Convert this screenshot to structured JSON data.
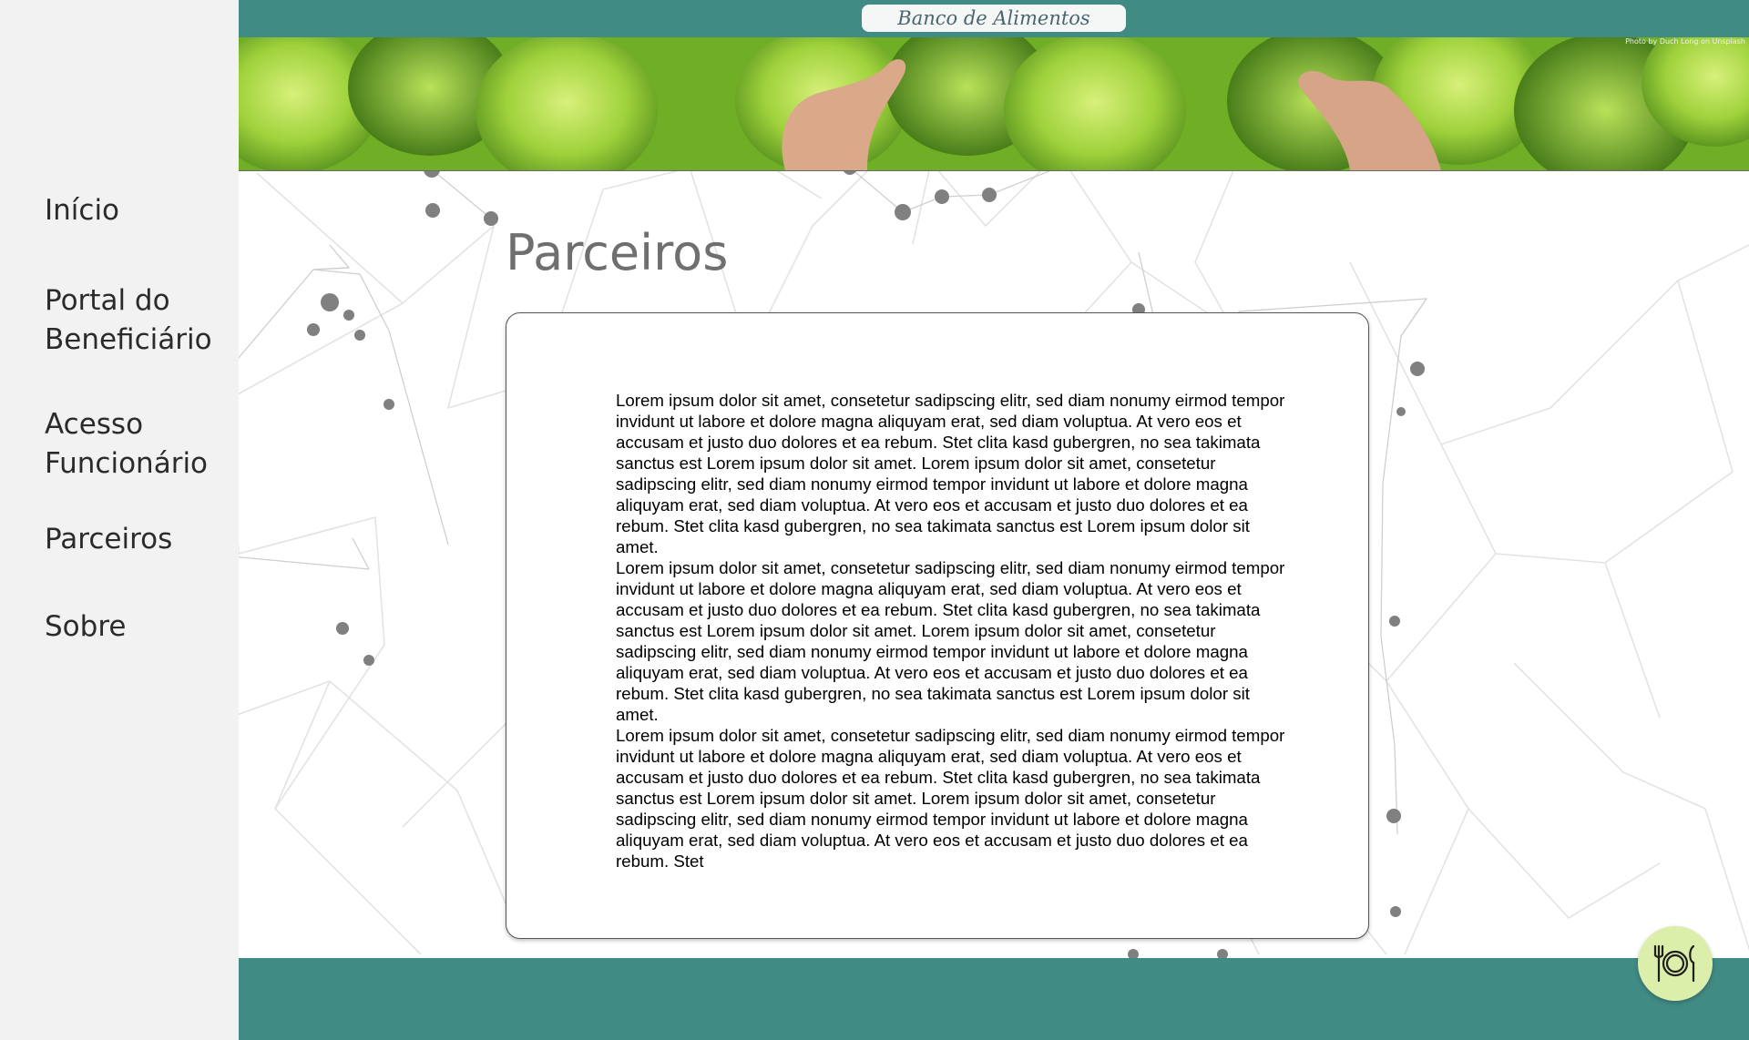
{
  "sidebar": {
    "items": [
      {
        "label": "Início"
      },
      {
        "label": "Portal do Beneficiário"
      },
      {
        "label": "Acesso Funcionário"
      },
      {
        "label": "Parceiros"
      },
      {
        "label": "Sobre"
      }
    ]
  },
  "header": {
    "brand": "Banco de Alimentos",
    "photo_credit": "Photo by Duch Long on Unsplash"
  },
  "main": {
    "title": "Parceiros",
    "paragraphs": [
      "Lorem ipsum dolor sit amet, consetetur sadipscing elitr, sed diam nonumy eirmod tempor invidunt ut labore et dolore magna aliquyam erat, sed diam voluptua. At vero eos et accusam et justo duo dolores et ea rebum. Stet clita kasd gubergren, no sea takimata sanctus est Lorem ipsum dolor sit amet. Lorem ipsum dolor sit amet, consetetur sadipscing elitr, sed diam nonumy eirmod tempor invidunt ut labore et dolore magna aliquyam erat, sed diam voluptua. At vero eos et accusam et justo duo dolores et ea rebum. Stet clita kasd gubergren, no sea takimata sanctus est Lorem ipsum dolor sit amet.",
      "Lorem ipsum dolor sit amet, consetetur sadipscing elitr, sed diam nonumy eirmod tempor invidunt ut labore et dolore magna aliquyam erat, sed diam voluptua. At vero eos et accusam et justo duo dolores et ea rebum. Stet clita kasd gubergren, no sea takimata sanctus est Lorem ipsum dolor sit amet. Lorem ipsum dolor sit amet, consetetur sadipscing elitr, sed diam nonumy eirmod tempor invidunt ut labore et dolore magna aliquyam erat, sed diam voluptua. At vero eos et accusam et justo duo dolores et ea rebum. Stet clita kasd gubergren, no sea takimata sanctus est Lorem ipsum dolor sit amet.",
      "Lorem ipsum dolor sit amet, consetetur sadipscing elitr, sed diam nonumy eirmod tempor invidunt ut labore et dolore magna aliquyam erat, sed diam voluptua. At vero eos et accusam et justo duo dolores et ea rebum. Stet clita kasd gubergren, no sea takimata sanctus est Lorem ipsum dolor sit amet. Lorem ipsum dolor sit amet, consetetur sadipscing elitr, sed diam nonumy eirmod tempor invidunt ut labore et dolore magna aliquyam erat, sed diam voluptua. At vero eos et accusam et justo duo dolores et ea rebum. Stet"
    ]
  },
  "fab": {
    "icon": "plate-cutlery-icon"
  },
  "colors": {
    "header_teal": "#418b85",
    "sidebar_bg": "#f2f2f2",
    "fab_bg": "#dbeeaa"
  }
}
